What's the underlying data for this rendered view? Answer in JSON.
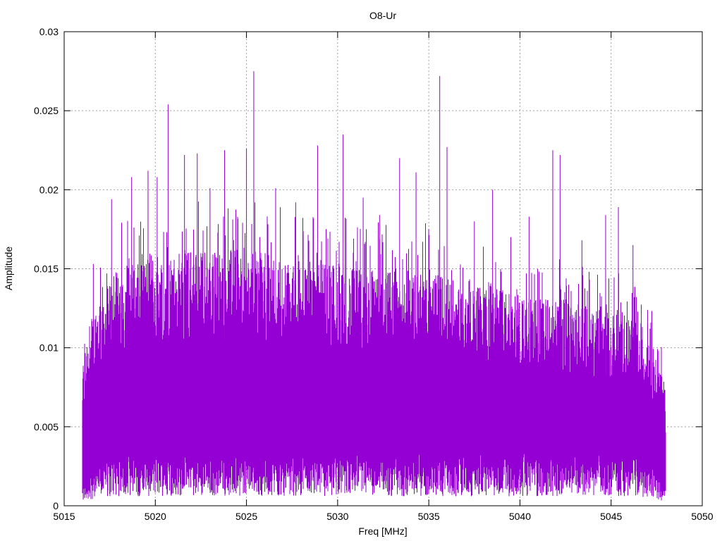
{
  "chart_data": {
    "type": "line",
    "title": "O8-Ur",
    "xlabel": "Freq [MHz]",
    "ylabel": "Amplitude",
    "xlim": [
      5015,
      5050
    ],
    "ylim": [
      0,
      0.03
    ],
    "x_ticks": [
      "5015",
      "5020",
      "5025",
      "5030",
      "5035",
      "5040",
      "5045",
      "5050"
    ],
    "y_ticks": [
      "0",
      "0.005",
      "0.01",
      "0.015",
      "0.02",
      "0.025",
      "0.03"
    ],
    "grid": true,
    "legend": "none",
    "series_color": "#9400d3",
    "series": [
      {
        "x_range": [
          5016.0,
          5048.0
        ],
        "envelope": {
          "x": [
            5016.0,
            5016.5,
            5017.0,
            5018.0,
            5019.0,
            5020.0,
            5021.0,
            5022.0,
            5023.0,
            5024.0,
            5025.0,
            5026.0,
            5027.0,
            5028.0,
            5029.0,
            5030.0,
            5031.0,
            5032.0,
            5033.0,
            5034.0,
            5035.0,
            5036.0,
            5037.0,
            5038.0,
            5039.0,
            5040.0,
            5041.0,
            5042.0,
            5043.0,
            5044.0,
            5045.0,
            5046.0,
            5047.0,
            5047.5,
            5048.0
          ],
          "typical_max": [
            0.0075,
            0.01,
            0.0115,
            0.0125,
            0.013,
            0.0135,
            0.0135,
            0.0135,
            0.0135,
            0.0135,
            0.0135,
            0.0135,
            0.013,
            0.013,
            0.013,
            0.0128,
            0.0125,
            0.0125,
            0.0125,
            0.0125,
            0.0125,
            0.0122,
            0.012,
            0.0118,
            0.0115,
            0.0112,
            0.011,
            0.011,
            0.0108,
            0.0105,
            0.0105,
            0.01,
            0.009,
            0.008,
            0.006
          ],
          "typical_min": [
            0.001,
            0.002,
            0.0025,
            0.003,
            0.003,
            0.003,
            0.003,
            0.003,
            0.003,
            0.003,
            0.003,
            0.003,
            0.003,
            0.003,
            0.003,
            0.003,
            0.003,
            0.003,
            0.003,
            0.003,
            0.003,
            0.003,
            0.003,
            0.003,
            0.003,
            0.003,
            0.003,
            0.003,
            0.003,
            0.003,
            0.003,
            0.003,
            0.0025,
            0.002,
            0.001
          ]
        },
        "peaks": [
          {
            "x": 5016.6,
            "y": 0.0153
          },
          {
            "x": 5017.6,
            "y": 0.0194
          },
          {
            "x": 5018.7,
            "y": 0.0208
          },
          {
            "x": 5019.6,
            "y": 0.0212
          },
          {
            "x": 5020.1,
            "y": 0.0208
          },
          {
            "x": 5020.7,
            "y": 0.0254
          },
          {
            "x": 5021.6,
            "y": 0.0222
          },
          {
            "x": 5022.3,
            "y": 0.0223
          },
          {
            "x": 5023.0,
            "y": 0.0201
          },
          {
            "x": 5023.8,
            "y": 0.0225
          },
          {
            "x": 5025.0,
            "y": 0.0226
          },
          {
            "x": 5025.4,
            "y": 0.0275
          },
          {
            "x": 5026.6,
            "y": 0.0201
          },
          {
            "x": 5027.7,
            "y": 0.0192
          },
          {
            "x": 5028.9,
            "y": 0.0228
          },
          {
            "x": 5030.3,
            "y": 0.0235
          },
          {
            "x": 5031.4,
            "y": 0.0195
          },
          {
            "x": 5032.3,
            "y": 0.0184
          },
          {
            "x": 5033.4,
            "y": 0.022
          },
          {
            "x": 5034.3,
            "y": 0.0211
          },
          {
            "x": 5035.6,
            "y": 0.0272
          },
          {
            "x": 5036.0,
            "y": 0.0227
          },
          {
            "x": 5037.5,
            "y": 0.018
          },
          {
            "x": 5038.5,
            "y": 0.02
          },
          {
            "x": 5039.5,
            "y": 0.017
          },
          {
            "x": 5040.5,
            "y": 0.0183
          },
          {
            "x": 5041.8,
            "y": 0.0225
          },
          {
            "x": 5042.2,
            "y": 0.0222
          },
          {
            "x": 5043.4,
            "y": 0.0168
          },
          {
            "x": 5044.7,
            "y": 0.0184
          },
          {
            "x": 5045.4,
            "y": 0.0189
          },
          {
            "x": 5046.2,
            "y": 0.0165
          },
          {
            "x": 5047.0,
            "y": 0.0124
          },
          {
            "x": 5047.6,
            "y": 0.0098
          }
        ]
      }
    ]
  }
}
